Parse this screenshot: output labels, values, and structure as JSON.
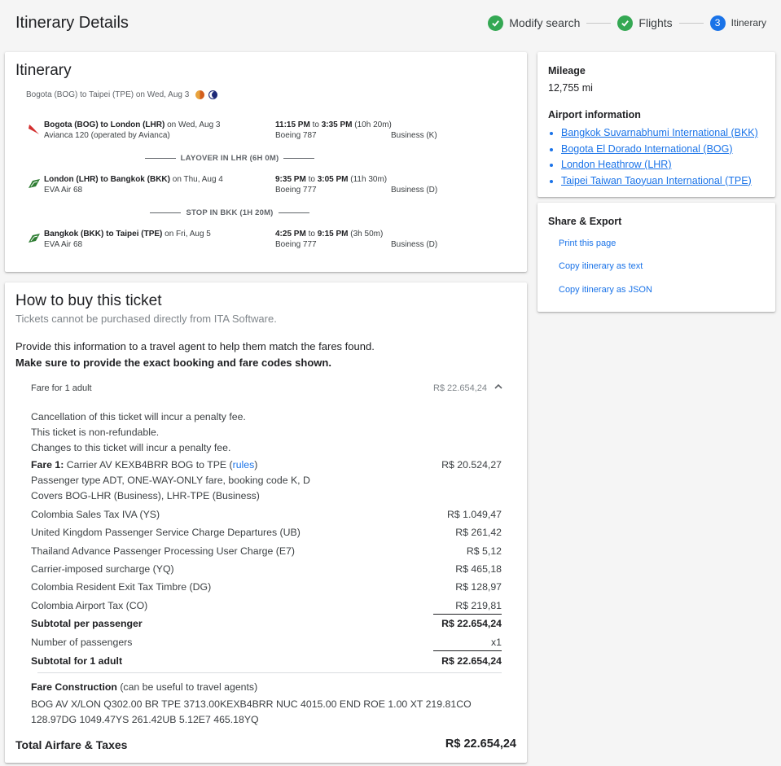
{
  "header": {
    "title": "Itinerary Details",
    "steps": [
      {
        "label": "Modify search",
        "state": "done"
      },
      {
        "label": "Flights",
        "state": "done"
      },
      {
        "label": "Itinerary",
        "number": "3",
        "state": "current"
      }
    ]
  },
  "itinerary": {
    "title": "Itinerary",
    "subtitle": "Bogota (BOG) to Taipei (TPE) on Wed, Aug 3",
    "segments": [
      {
        "route": "Bogota (BOG) to London (LHR)",
        "date": " on Wed, Aug 3",
        "carrier": "Avianca 120 (operated by Avianca)",
        "dep": "11:15 PM",
        "to": " to ",
        "arr": "3:35 PM",
        "duration": " (10h 20m)",
        "aircraft": "Boeing 787",
        "cabin": "Business (K)"
      },
      {
        "route": "London (LHR) to Bangkok (BKK)",
        "date": " on Thu, Aug 4",
        "carrier": "EVA Air 68",
        "dep": "9:35 PM",
        "to": " to ",
        "arr": "3:05 PM",
        "duration": " (11h 30m)",
        "aircraft": "Boeing 777",
        "cabin": "Business (D)"
      },
      {
        "route": "Bangkok (BKK) to Taipei (TPE)",
        "date": " on Fri, Aug 5",
        "carrier": "EVA Air 68",
        "dep": "4:25 PM",
        "to": " to ",
        "arr": "9:15 PM",
        "duration": " (3h 50m)",
        "aircraft": "Boeing 777",
        "cabin": "Business (D)"
      }
    ],
    "layovers": [
      "LAYOVER IN LHR (6H 0M)",
      "STOP IN BKK (1H 20M)"
    ]
  },
  "buy": {
    "title": "How to buy this ticket",
    "subtitle": "Tickets cannot be purchased directly from ITA Software.",
    "info": "Provide this information to a travel agent to help them match the fares found.",
    "info_bold": "Make sure to provide the exact booking and fare codes shown.",
    "fare_header": "Fare for 1 adult",
    "fare_header_amount": "R$ 22.654,24",
    "notes": [
      "Cancellation of this ticket will incur a penalty fee.",
      "This ticket is non-refundable.",
      "Changes to this ticket will incur a penalty fee."
    ],
    "fare1_label": "Fare 1:",
    "fare1_text": " Carrier AV KEXB4BRR BOG to TPE (",
    "fare1_rules": "rules",
    "fare1_close": ")",
    "fare1_amount": "R$ 20.524,27",
    "fare1_line2": "Passenger type ADT, ONE-WAY-ONLY fare, booking code K, D",
    "fare1_line3": "Covers BOG-LHR (Business), LHR-TPE (Business)",
    "taxes": [
      {
        "label": "Colombia Sales Tax IVA (YS)",
        "amount": "R$ 1.049,47"
      },
      {
        "label": "United Kingdom Passenger Service Charge Departures (UB)",
        "amount": "R$ 261,42"
      },
      {
        "label": "Thailand Advance Passenger Processing User Charge (E7)",
        "amount": "R$ 5,12"
      },
      {
        "label": "Carrier-imposed surcharge (YQ)",
        "amount": "R$ 465,18"
      },
      {
        "label": "Colombia Resident Exit Tax Timbre (DG)",
        "amount": "R$ 128,97"
      },
      {
        "label": "Colombia Airport Tax (CO)",
        "amount": "R$ 219,81"
      }
    ],
    "subtotal_pp_label": "Subtotal per passenger",
    "subtotal_pp_amount": "R$ 22.654,24",
    "passengers_label": "Number of passengers",
    "passengers_value": "x1",
    "subtotal_label": "Subtotal for 1 adult",
    "subtotal_amount": "R$ 22.654,24",
    "fc_label": "Fare Construction",
    "fc_note": " (can be useful to travel agents)",
    "fc_text": "BOG AV X/LON Q302.00 BR TPE 3713.00KEXB4BRR NUC 4015.00 END ROE 1.00 XT 219.81CO 128.97DG 1049.47YS 261.42UB 5.12E7 465.18YQ",
    "total_label": "Total Airfare & Taxes",
    "total_amount": "R$ 22.654,24"
  },
  "mileage": {
    "title": "Mileage",
    "value": "12,755 mi",
    "airport_title": "Airport information",
    "airports": [
      "Bangkok Suvarnabhumi International (BKK)",
      "Bogota El Dorado International (BOG)",
      "London Heathrow (LHR)",
      "Taipei Taiwan Taoyuan International (TPE)"
    ]
  },
  "share": {
    "title": "Share & Export",
    "links": [
      "Print this page",
      "Copy itinerary as text",
      "Copy itinerary as JSON"
    ]
  },
  "colors": {
    "accent": "#1a73e8",
    "success": "#34a853",
    "avianca": "#d32f2f",
    "eva": "#2e7d32"
  }
}
